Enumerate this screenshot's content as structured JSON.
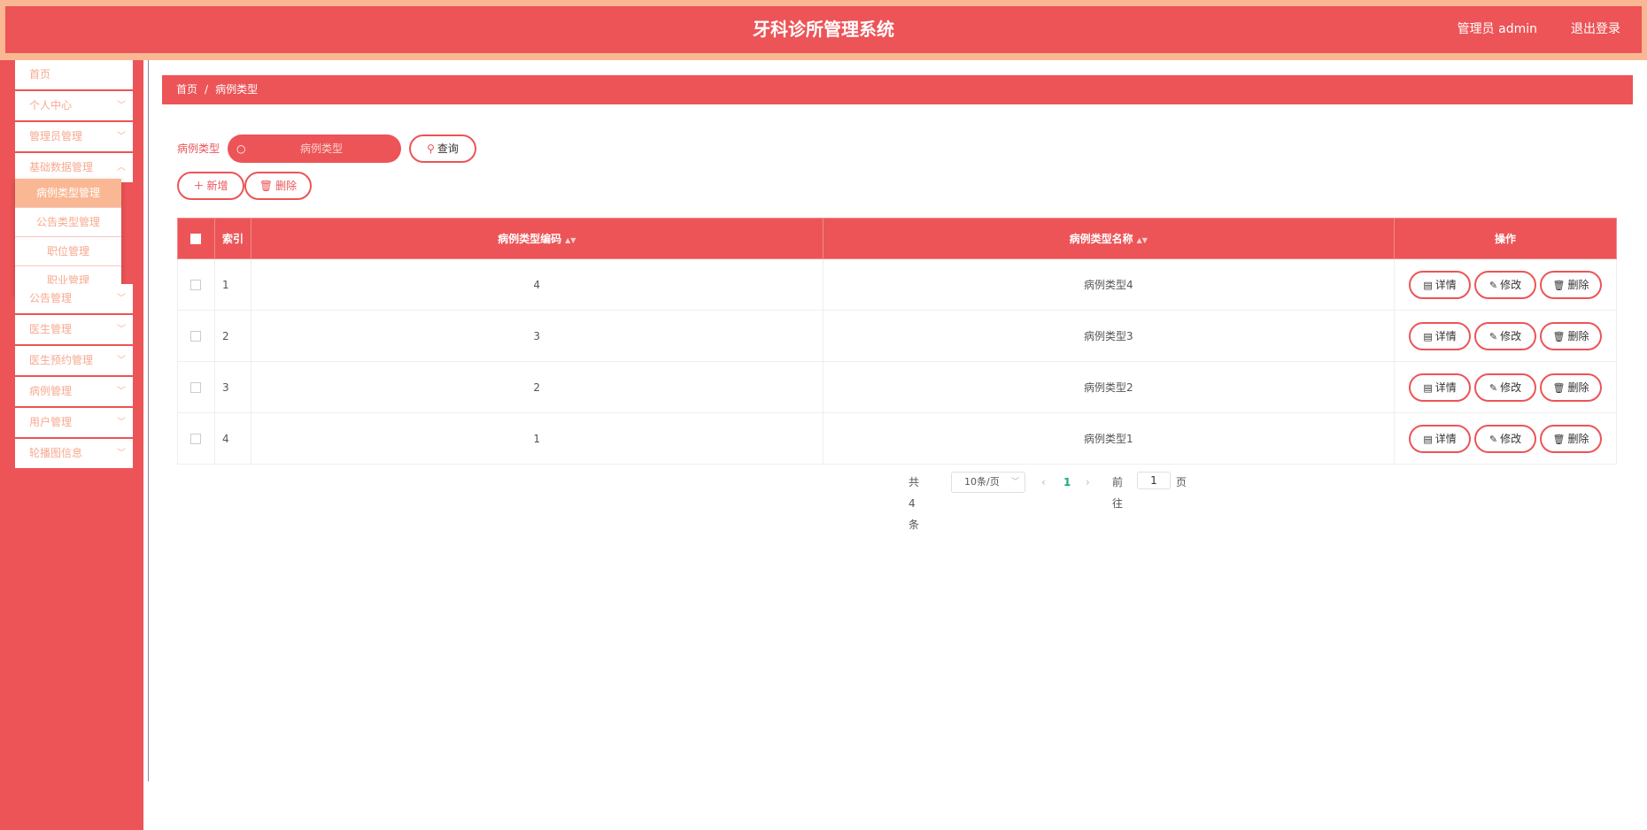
{
  "app": {
    "title": "牙科诊所管理系统",
    "user": "管理员 admin",
    "logout": "退出登录"
  },
  "sidebar": {
    "items": [
      {
        "label": "首页",
        "has_arrow": false
      },
      {
        "label": "个人中心",
        "has_arrow": true
      },
      {
        "label": "管理员管理",
        "has_arrow": true
      },
      {
        "label": "基础数据管理",
        "has_arrow": true
      },
      {
        "label": "公告管理",
        "has_arrow": true
      },
      {
        "label": "医生管理",
        "has_arrow": true
      },
      {
        "label": "医生预约管理",
        "has_arrow": true
      },
      {
        "label": "病例管理",
        "has_arrow": true
      },
      {
        "label": "用户管理",
        "has_arrow": true
      },
      {
        "label": "轮播图信息",
        "has_arrow": true
      }
    ],
    "submenu": [
      {
        "label": "病例类型管理",
        "active": true
      },
      {
        "label": "公告类型管理",
        "active": false
      },
      {
        "label": "职位管理",
        "active": false
      },
      {
        "label": "职业管理",
        "active": false
      }
    ]
  },
  "breadcrumb": {
    "home": "首页",
    "separator": "/",
    "current": "病例类型"
  },
  "search": {
    "label": "病例类型",
    "placeholder": "病例类型",
    "button": "查询"
  },
  "actions": {
    "add": "新增",
    "delete": "删除"
  },
  "table": {
    "headers": {
      "index": "索引",
      "code": "病例类型编码",
      "name": "病例类型名称",
      "ops": "操作"
    },
    "rows": [
      {
        "index": "1",
        "code": "4",
        "name": "病例类型4"
      },
      {
        "index": "2",
        "code": "3",
        "name": "病例类型3"
      },
      {
        "index": "3",
        "code": "2",
        "name": "病例类型2"
      },
      {
        "index": "4",
        "code": "1",
        "name": "病例类型1"
      }
    ],
    "row_actions": {
      "detail": "详情",
      "edit": "修改",
      "delete": "删除"
    }
  },
  "pagination": {
    "total": "共 4 条",
    "page_size": "10条/页",
    "current_page": "1",
    "goto_label": "前往",
    "goto_value": "1",
    "page_suffix": "页"
  },
  "colors": {
    "primary": "#ec5457",
    "accent": "#f9b893",
    "active_page": "#1aa97a"
  }
}
